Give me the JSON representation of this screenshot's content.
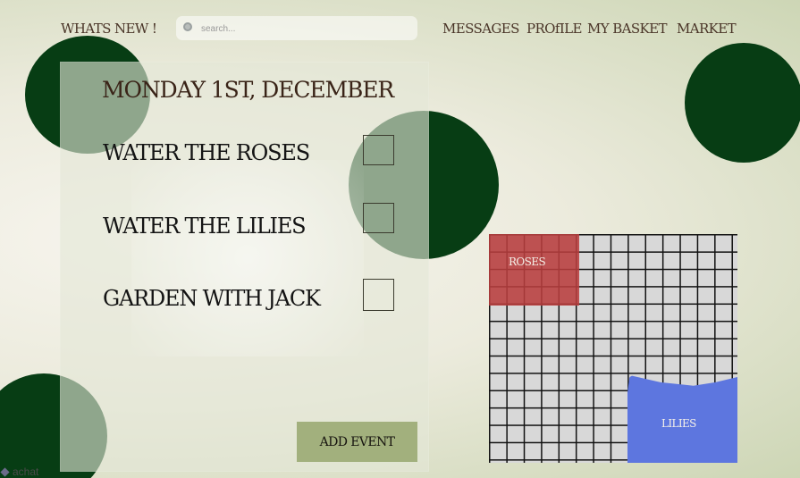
{
  "nav": {
    "whats_new": "WHATS NEW !",
    "messages": "MESSAGES",
    "profile": "PROfILE",
    "basket": "MY BASKET",
    "market": "MARKET"
  },
  "search": {
    "placeholder": "search...",
    "icon": "search-icon"
  },
  "panel": {
    "date": "MONDAY  1ST, DECEMBER",
    "tasks": [
      {
        "label": "WATER THE ROSES",
        "checked": false
      },
      {
        "label": "WATER THE LILIES",
        "checked": false
      },
      {
        "label": "GARDEN WITH JACK",
        "checked": false
      }
    ],
    "add_event_label": "ADD EVENT"
  },
  "garden": {
    "zones": [
      {
        "label": "ROSES",
        "color": "#b83e3e"
      },
      {
        "label": "LILIES",
        "color": "#5d76df"
      }
    ]
  },
  "watermark": {
    "text": "achat"
  },
  "colors": {
    "dark_green": "#073d14",
    "button_green": "#a2b07d",
    "nav_text": "#4a3528"
  }
}
